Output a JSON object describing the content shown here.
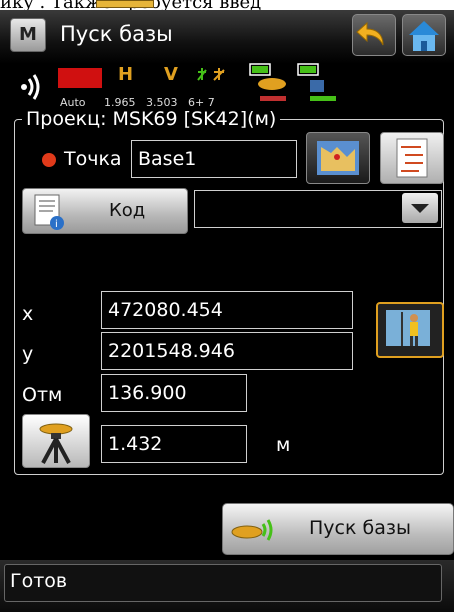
{
  "doc": {
    "snippet": "ику        . Также требуется введ"
  },
  "app": {
    "title": "Пуск базы",
    "menu_letter": "M"
  },
  "status": {
    "mode": "Auto",
    "h_label": "H",
    "v_label": "V",
    "h_value": "1.965",
    "v_value": "3.503",
    "sats": "6+ 7",
    "colors": {
      "accent": "#e0a020",
      "red": "#d01010",
      "green": "#46c018"
    }
  },
  "project": {
    "label": "Проекц: MSK69 [SK42](м)"
  },
  "point": {
    "label": "Точка",
    "value": "Base1"
  },
  "code": {
    "button_label": "Код",
    "value": ""
  },
  "coords": {
    "x_label": "x",
    "x_value": "472080.454",
    "y_label": "y",
    "y_value": "2201548.946",
    "elev_label": "Отм",
    "elev_value": "136.900"
  },
  "antenna": {
    "height": "1.432",
    "unit": "м"
  },
  "actions": {
    "start_label": "Пуск базы"
  },
  "statusbar": {
    "text": "Готов"
  },
  "icons": [
    "menu-icon",
    "back-arrow-icon",
    "home-icon",
    "radio-signal-icon",
    "battery-icon",
    "satellite-icon",
    "map-icon",
    "list-icon",
    "document-info-icon",
    "surveyor-icon",
    "tripod-icon",
    "base-antenna-icon"
  ]
}
